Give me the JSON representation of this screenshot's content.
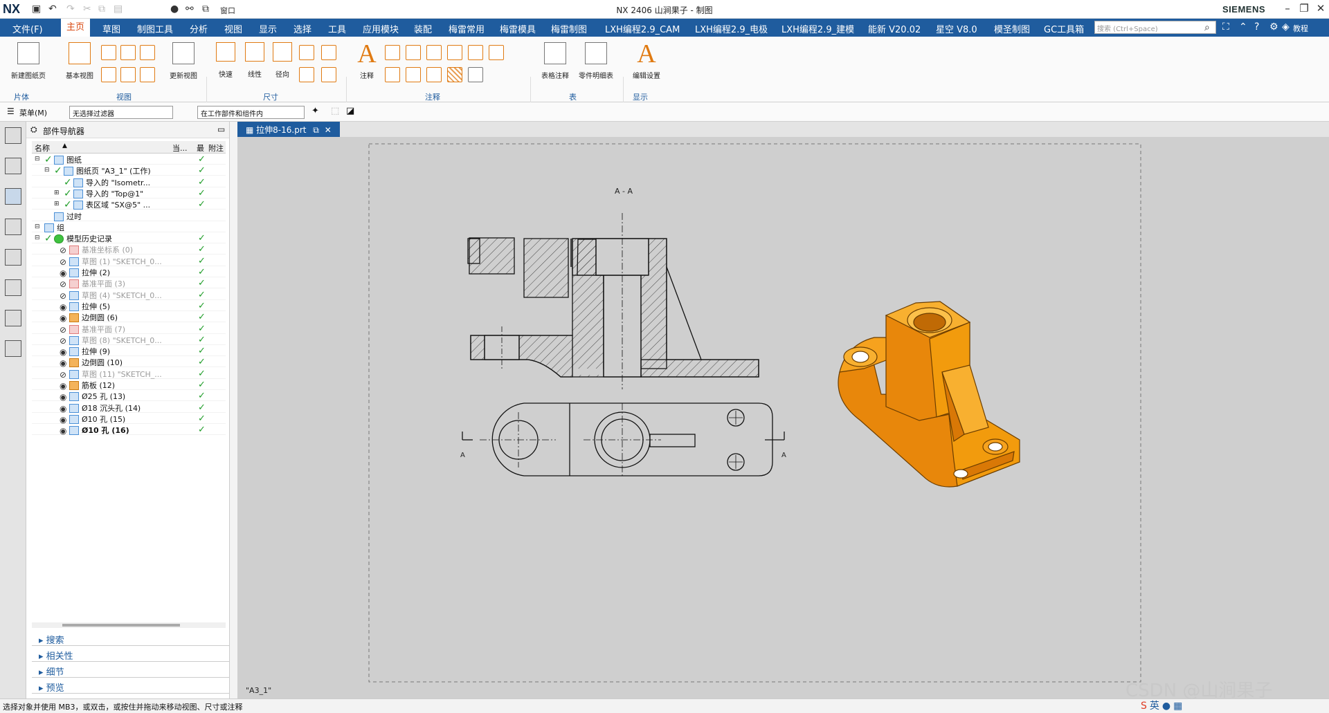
{
  "titlebar": {
    "logo": "NX",
    "title": "NX 2406  山涧果子 - 制图",
    "brand": "SIEMENS",
    "window_menu": "窗口",
    "quick_access": [
      "save-icon",
      "undo-icon",
      "redo-icon",
      "copy-icon",
      "paste-icon",
      "cut-icon",
      "mic-icon",
      "link-icon",
      "window-icon"
    ]
  },
  "menubar": {
    "items": [
      "文件(F)",
      "主页",
      "草图",
      "制图工具",
      "分析",
      "视图",
      "显示",
      "选择",
      "工具",
      "应用模块",
      "装配",
      "梅雷常用",
      "梅雷模具",
      "梅雷制图",
      "LXH编程2.9_CAM",
      "LXH编程2.9_电极",
      "LXH编程2.9_建模",
      "能新 V20.02",
      "星空 V8.0",
      "模圣制图",
      "GC工具箱"
    ],
    "active_index": 1,
    "search_placeholder": "搜索 (Ctrl+Space)",
    "tutorial": "教程"
  },
  "ribbon": {
    "buttons": {
      "new_sheet": "新建图纸页",
      "base_view": "基本视图",
      "update_view": "更新视图",
      "quick_dim": "快速",
      "linear_dim": "线性",
      "radial_dim": "径向",
      "note": "注释",
      "table_note": "表格注释",
      "parts_list": "零件明细表",
      "edit_settings": "编辑设置"
    },
    "groups": [
      "片体",
      "视图",
      "尺寸",
      "注释",
      "表",
      "显示"
    ]
  },
  "filterbar": {
    "menu": "菜单(M)",
    "filter": "无选择过滤器",
    "scope": "在工作部件和组件内"
  },
  "navigator": {
    "title": "部件导航器",
    "columns": [
      "名称",
      "当...",
      "最",
      "附注"
    ],
    "rows": [
      {
        "label": "图纸",
        "indent": 0,
        "style": "normal",
        "check": true
      },
      {
        "label": "图纸页 \"A3_1\" (工作)",
        "indent": 1,
        "style": "normal",
        "check": true
      },
      {
        "label": "导入的 \"Isometr...",
        "indent": 2,
        "style": "normal",
        "check": true
      },
      {
        "label": "导入的 \"Top@1\"",
        "indent": 2,
        "style": "normal",
        "check": true
      },
      {
        "label": "表区域 \"SX@5\" ...",
        "indent": 2,
        "style": "normal",
        "check": true
      },
      {
        "label": "过时",
        "indent": 1,
        "style": "normal",
        "check": false
      },
      {
        "label": "组",
        "indent": 0,
        "style": "normal",
        "check": false
      },
      {
        "label": "模型历史记录",
        "indent": 0,
        "style": "normal",
        "check": true
      },
      {
        "label": "基准坐标系 (0)",
        "indent": 1,
        "style": "faded",
        "check": true
      },
      {
        "label": "草图 (1) \"SKETCH_0...",
        "indent": 1,
        "style": "faded",
        "check": true
      },
      {
        "label": "拉伸 (2)",
        "indent": 1,
        "style": "normal",
        "check": true
      },
      {
        "label": "基准平面 (3)",
        "indent": 1,
        "style": "faded",
        "check": true
      },
      {
        "label": "草图 (4) \"SKETCH_0...",
        "indent": 1,
        "style": "faded",
        "check": true
      },
      {
        "label": "拉伸 (5)",
        "indent": 1,
        "style": "normal",
        "check": true
      },
      {
        "label": "边倒圆 (6)",
        "indent": 1,
        "style": "normal",
        "check": true
      },
      {
        "label": "基准平面 (7)",
        "indent": 1,
        "style": "faded",
        "check": true
      },
      {
        "label": "草图 (8) \"SKETCH_0...",
        "indent": 1,
        "style": "faded",
        "check": true
      },
      {
        "label": "拉伸 (9)",
        "indent": 1,
        "style": "normal",
        "check": true
      },
      {
        "label": "边倒圆 (10)",
        "indent": 1,
        "style": "normal",
        "check": true
      },
      {
        "label": "草图 (11) \"SKETCH_...",
        "indent": 1,
        "style": "faded",
        "check": true
      },
      {
        "label": "筋板 (12)",
        "indent": 1,
        "style": "normal",
        "check": true
      },
      {
        "label": "Ø25 孔 (13)",
        "indent": 1,
        "style": "normal",
        "check": true
      },
      {
        "label": "Ø18 沉头孔 (14)",
        "indent": 1,
        "style": "normal",
        "check": true
      },
      {
        "label": "Ø10 孔 (15)",
        "indent": 1,
        "style": "normal",
        "check": true
      },
      {
        "label": "Ø10 孔 (16)",
        "indent": 1,
        "style": "bold",
        "check": true
      }
    ],
    "sections": [
      "搜索",
      "相关性",
      "细节",
      "预览"
    ]
  },
  "document": {
    "tab": "拉伸8-16.prt",
    "sheet": "\"A3_1\"",
    "section_label": "A - A",
    "cut_label": "A"
  },
  "status": {
    "text": "选择对象并使用 MB3，或双击，或按住并拖动来移动视图、尺寸或注释"
  },
  "watermark": "CSDN @山涧果子",
  "colors": {
    "accent": "#1f5c9e",
    "active_tab_text": "#d9480f",
    "model": "#f29b0d",
    "check": "#1f9d28"
  }
}
